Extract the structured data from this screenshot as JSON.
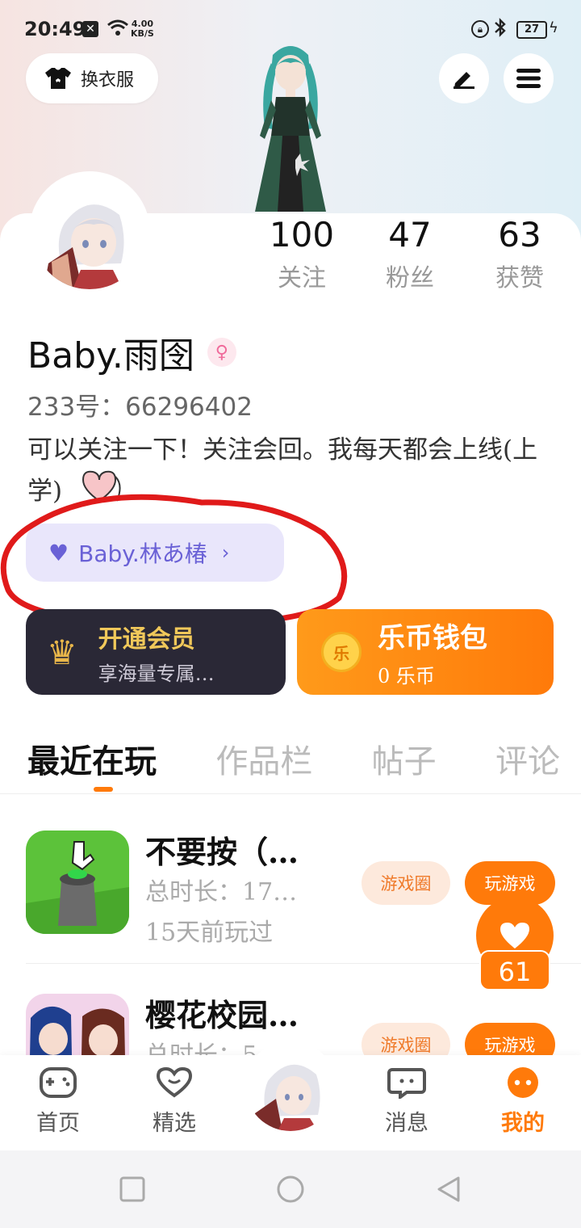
{
  "status_bar": {
    "time": "20:49",
    "net_speed": "4.00",
    "net_unit": "KB/S",
    "battery": "27"
  },
  "header": {
    "clothes_label": "换衣服",
    "edit_icon": "pen-icon",
    "menu_icon": "hamburger-menu-icon"
  },
  "stats": {
    "following": {
      "value": "100",
      "label": "关注"
    },
    "followers": {
      "value": "47",
      "label": "粉丝"
    },
    "likes": {
      "value": "63",
      "label": "获赞"
    }
  },
  "profile": {
    "username": "Baby.雨囹",
    "gender": "female",
    "uid": "233号：66296402",
    "bio": "可以关注一下！关注会回。我每天都会上线(上学)",
    "couple_name": "Baby.林あ椿"
  },
  "cards": {
    "vip_title": "开通会员",
    "vip_sub": "享海量专属…",
    "wallet_title": "乐币钱包",
    "wallet_coin": "乐",
    "wallet_balance": "0 乐币"
  },
  "tabs": [
    "最近在玩",
    "作品栏",
    "帖子",
    "评论"
  ],
  "games": [
    {
      "name": "不要按（…",
      "duration": "总时长：17…",
      "last_played": "15天前玩过",
      "circle": "游戏圈",
      "play": "玩游戏"
    },
    {
      "name": "樱花校园…",
      "duration": "总时长：5…",
      "circle": "游戏圈",
      "play": "玩游戏"
    }
  ],
  "floating_like": {
    "count": "61"
  },
  "bottom_nav": [
    {
      "label": "首页",
      "icon": "gamepad-icon"
    },
    {
      "label": "精选",
      "icon": "heart-chat-icon"
    },
    {
      "label": "消息",
      "icon": "message-icon"
    },
    {
      "label": "我的",
      "icon": "profile-dots-icon"
    }
  ],
  "colors": {
    "accent": "#ff7a0a",
    "couple": "#6a61d6",
    "vip_bg": "#2a2836"
  }
}
